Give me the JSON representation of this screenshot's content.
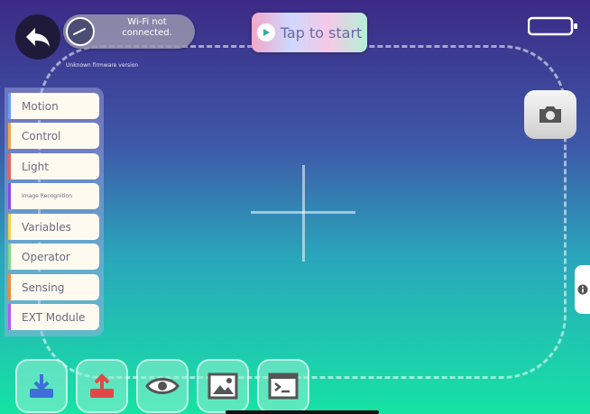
{
  "status": {
    "wifi_text": "Wi-Fi not connected.",
    "firmware_text": "Unknown firmware version"
  },
  "header": {
    "tap_to_start_label": "Tap to start"
  },
  "palette": {
    "categories": [
      {
        "label": "Motion",
        "color": "#6a9df0"
      },
      {
        "label": "Control",
        "color": "#f0a648"
      },
      {
        "label": "Light",
        "color": "#e8615f"
      },
      {
        "label": "Image Recognition",
        "color": "#8a49e0"
      },
      {
        "label": "Variables",
        "color": "#f0d24a"
      },
      {
        "label": "Operator",
        "color": "#7fd98a"
      },
      {
        "label": "Sensing",
        "color": "#f08a3a"
      },
      {
        "label": "EXT Module",
        "color": "#b05ce8"
      }
    ]
  },
  "toolbar": {
    "buttons": [
      "download-icon",
      "upload-icon",
      "eye-icon",
      "image-icon",
      "terminal-icon"
    ]
  },
  "colors": {
    "gradient_top": "#3b2a86",
    "gradient_bottom": "#16e3a4",
    "back_button_bg": "#1f1a3a"
  }
}
